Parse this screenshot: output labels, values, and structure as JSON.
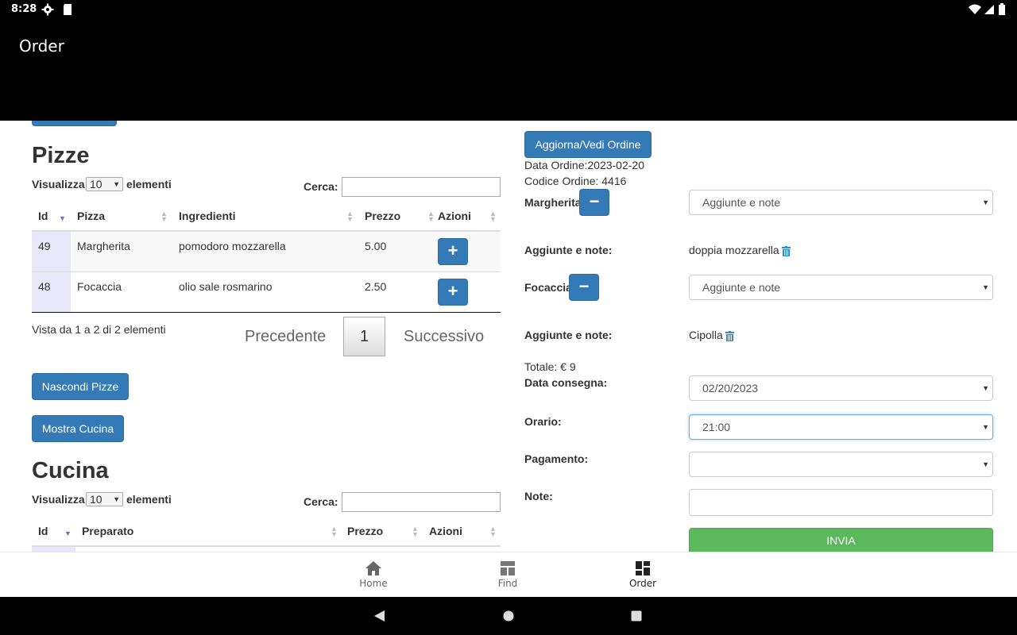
{
  "status": {
    "time": "8:28"
  },
  "appbar": {
    "title": "Order"
  },
  "pizze": {
    "title": "Pizze",
    "show_label": "Visualizza",
    "page_size": "10",
    "elements_label": "elementi",
    "search_label": "Cerca:",
    "columns": [
      "Id",
      "Pizza",
      "Ingredienti",
      "Prezzo",
      "Azioni"
    ],
    "rows": [
      {
        "id": "49",
        "name": "Margherita",
        "ingredients": "pomodoro mozzarella",
        "price": "5.00",
        "action": "+"
      },
      {
        "id": "48",
        "name": "Focaccia",
        "ingredients": "olio sale rosmarino",
        "price": "2.50",
        "action": "+"
      }
    ],
    "info": "Vista da 1 a 2 di 2 elementi",
    "pager": {
      "prev": "Precedente",
      "page": "1",
      "next": "Successivo"
    },
    "hide_button": "Nascondi Pizze"
  },
  "cucina": {
    "show_button": "Mostra Cucina",
    "title": "Cucina",
    "show_label": "Visualizza",
    "page_size": "10",
    "elements_label": "elementi",
    "search_label": "Cerca:",
    "columns": [
      "Id",
      "Preparato",
      "Prezzo",
      "Azioni"
    ]
  },
  "order": {
    "update_button": "Aggiorna/Vedi Ordine",
    "date_line": "Data Ordine:2023-02-20",
    "code_line": "Codice Ordine: 4416",
    "items": [
      {
        "name": "Margherita",
        "remove": "−",
        "addon_placeholder": "Aggiunte e note",
        "addon_label": "Aggiunte e note:",
        "addon_value": "doppia mozzarella"
      },
      {
        "name": "Focaccia",
        "remove": "−",
        "addon_placeholder": "Aggiunte e note",
        "addon_label": "Aggiunte e note:",
        "addon_value": "Cipolla"
      }
    ],
    "total": "Totale: € 9",
    "delivery_label": "Data consegna:",
    "delivery_value": "02/20/2023",
    "time_label": "Orario:",
    "time_value": "21:00",
    "payment_label": "Pagamento:",
    "payment_value": "",
    "notes_label": "Note:",
    "submit": "INVIA"
  },
  "bottomnav": [
    {
      "label": "Home",
      "icon": "home-icon"
    },
    {
      "label": "Find",
      "icon": "find-icon"
    },
    {
      "label": "Order",
      "icon": "order-icon"
    }
  ],
  "colors": {
    "primary": "#337ab7",
    "success": "#5cb85c",
    "trash": "#2a8fdb"
  }
}
